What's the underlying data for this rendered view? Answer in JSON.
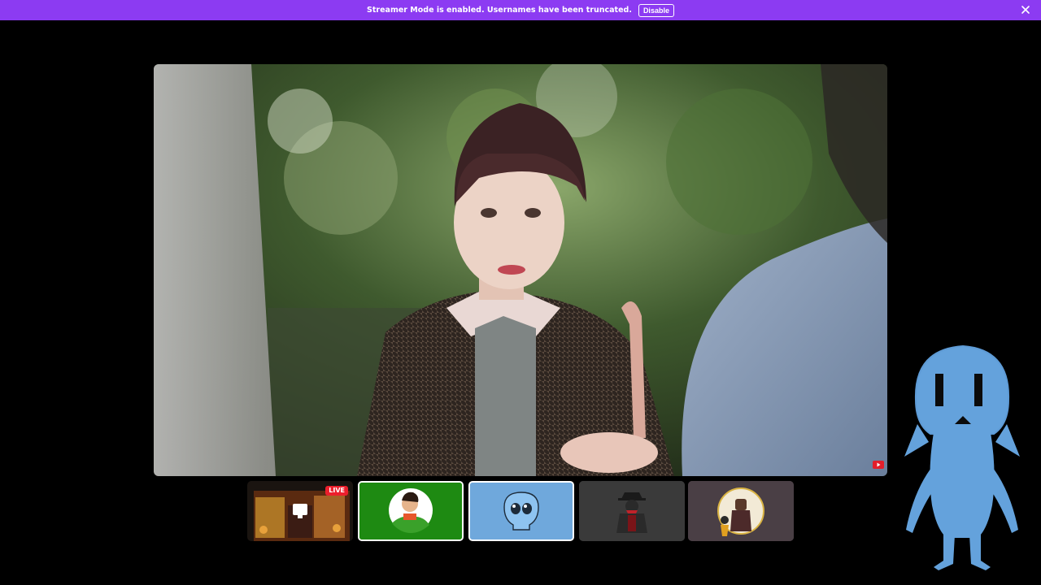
{
  "banner": {
    "message": "Streamer Mode is enabled. Usernames have been truncated.",
    "disable_label": "Disable",
    "color": "#8c3bf2"
  },
  "stream": {
    "badge_icon": "youtube-icon"
  },
  "participants": [
    {
      "type": "screenshare",
      "live_label": "LIVE"
    },
    {
      "type": "avatar",
      "background": "#1e8a12",
      "avatar": "green-hero-avatar"
    },
    {
      "type": "avatar",
      "background": "#6fa8dc",
      "avatar": "blue-alien-avatar"
    },
    {
      "type": "avatar",
      "background": "#3a3a3a",
      "avatar": "hat-figure-avatar"
    },
    {
      "type": "avatar",
      "background": "#4a3f45",
      "avatar": "character-pair-avatar"
    }
  ],
  "overlay": {
    "icon": "blue-alien-mascot"
  }
}
